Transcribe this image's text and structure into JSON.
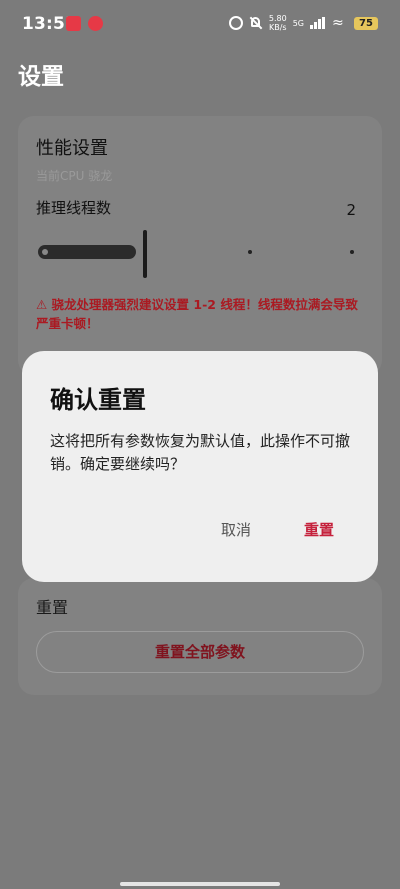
{
  "status_bar": {
    "time": "13:55",
    "net_speed_value": "5.80",
    "net_speed_unit": "KB/s",
    "network_type": "5G",
    "battery": "75"
  },
  "page": {
    "title": "设置"
  },
  "performance": {
    "title": "性能设置",
    "cpu_label": "当前CPU  骁龙",
    "threads_label": "推理线程数",
    "threads_value": "2",
    "warning": "⚠ 骁龙处理器强烈建议设置 1-2 线程！线程数拉满会导致严重卡顿！"
  },
  "reset_card": {
    "title": "重置",
    "reset_all_label": "重置全部参数"
  },
  "dialog": {
    "title": "确认重置",
    "message": "这将把所有参数恢复为默认值，此操作不可撤销。确定要继续吗？",
    "cancel_label": "取消",
    "confirm_label": "重置"
  },
  "colors": {
    "scrim": "#7b7b7b",
    "accent": "#c5213c",
    "warning": "#aa1a22"
  }
}
